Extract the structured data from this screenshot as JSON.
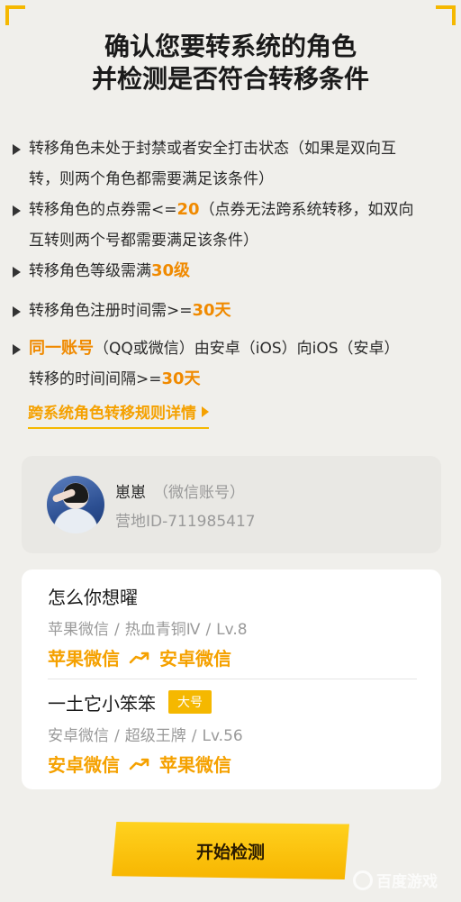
{
  "title": {
    "line1": "确认您要转系统的角色",
    "line2": "并检测是否符合转移条件"
  },
  "rules": [
    {
      "a": "转移角色未处于封禁或者安全打击状态（如果是双向互",
      "b": "转，则两个角色都需要满足该条件）"
    },
    {
      "pre": "转移角色的点券需<=",
      "hl": "20",
      "post": "（点券无法跨系统转移，如双向",
      "b": "互转则两个号都需要满足该条件）"
    },
    {
      "pre": "转移角色等级需满",
      "hl": "30级"
    },
    {
      "pre": "转移角色注册时间需>=",
      "hl": "30天"
    },
    {
      "hl_start": "同一账号",
      "mid": "（QQ或微信）由安卓（iOS）向iOS（安卓）",
      "b_pre": "转移的时间间隔>=",
      "b_hl": "30天"
    }
  ],
  "detail_link": "跨系统角色转移规则详情",
  "account": {
    "name": "崽崽",
    "type": "（微信账号）",
    "id": "营地ID-711985417"
  },
  "roles": [
    {
      "name": "怎么你想曜",
      "badge": "",
      "platform": "苹果微信",
      "rank": "热血青铜Ⅳ",
      "level": "Lv.8",
      "from": "苹果微信",
      "to": "安卓微信"
    },
    {
      "name": "一土它小笨笨",
      "badge": "大号",
      "platform": "安卓微信",
      "rank": "超级王牌",
      "level": "Lv.56",
      "from": "安卓微信",
      "to": "苹果微信"
    }
  ],
  "separator": "/",
  "start_button": "开始检测",
  "watermark": "百度游戏",
  "colors": {
    "accent": "#f5b800",
    "highlight": "#f08a00",
    "background": "#f0efeb"
  }
}
